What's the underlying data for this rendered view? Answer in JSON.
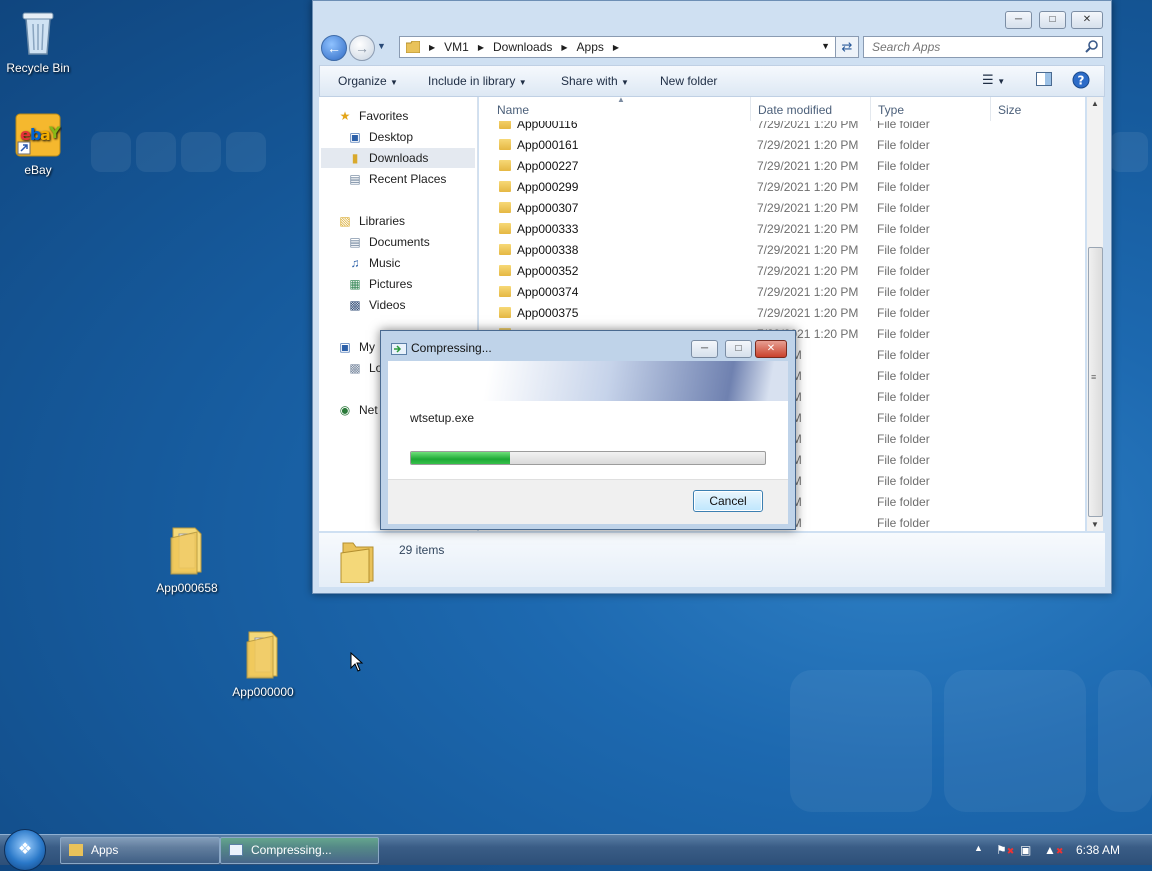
{
  "desktop": {
    "icons": [
      {
        "label": "Recycle Bin",
        "icon": "recycle-bin-icon"
      },
      {
        "label": "eBay",
        "icon": "ebay-icon"
      },
      {
        "label": "App000658",
        "icon": "folder-icon"
      },
      {
        "label": "App000000",
        "icon": "folder-icon"
      }
    ]
  },
  "explorer": {
    "breadcrumb": [
      "VM1",
      "Downloads",
      "Apps"
    ],
    "search_placeholder": "Search Apps",
    "toolbar": {
      "organize": "Organize",
      "include_in_library": "Include in library",
      "share_with": "Share with",
      "new_folder": "New folder"
    },
    "nav": {
      "favorites": "Favorites",
      "desktop": "Desktop",
      "downloads": "Downloads",
      "recent_places": "Recent Places",
      "libraries": "Libraries",
      "documents": "Documents",
      "music": "Music",
      "pictures": "Pictures",
      "videos": "Videos",
      "computer_partial": "My",
      "local_disk_partial": "Lo",
      "network_partial": "Net"
    },
    "columns": {
      "name": "Name",
      "date_modified": "Date modified",
      "type": "Type",
      "size": "Size"
    },
    "rows": [
      {
        "name": "App000116",
        "date": "7/29/2021 1:20 PM",
        "type": "File folder"
      },
      {
        "name": "App000161",
        "date": "7/29/2021 1:20 PM",
        "type": "File folder"
      },
      {
        "name": "App000227",
        "date": "7/29/2021 1:20 PM",
        "type": "File folder"
      },
      {
        "name": "App000299",
        "date": "7/29/2021 1:20 PM",
        "type": "File folder"
      },
      {
        "name": "App000307",
        "date": "7/29/2021 1:20 PM",
        "type": "File folder"
      },
      {
        "name": "App000333",
        "date": "7/29/2021 1:20 PM",
        "type": "File folder"
      },
      {
        "name": "App000338",
        "date": "7/29/2021 1:20 PM",
        "type": "File folder"
      },
      {
        "name": "App000352",
        "date": "7/29/2021 1:20 PM",
        "type": "File folder"
      },
      {
        "name": "App000374",
        "date": "7/29/2021 1:20 PM",
        "type": "File folder"
      },
      {
        "name": "App000375",
        "date": "7/29/2021 1:20 PM",
        "type": "File folder"
      },
      {
        "name": "",
        "date": "7/29/2021 1:20 PM",
        "type": "File folder"
      },
      {
        "name": "",
        "date": "1:20 PM",
        "type": "File folder"
      },
      {
        "name": "",
        "date": "1:20 PM",
        "type": "File folder"
      },
      {
        "name": "",
        "date": "1:20 PM",
        "type": "File folder"
      },
      {
        "name": "",
        "date": "1:20 PM",
        "type": "File folder"
      },
      {
        "name": "",
        "date": "1:20 PM",
        "type": "File folder"
      },
      {
        "name": "",
        "date": "1:20 PM",
        "type": "File folder"
      },
      {
        "name": "",
        "date": "1:20 PM",
        "type": "File folder"
      },
      {
        "name": "",
        "date": "1:20 PM",
        "type": "File folder"
      },
      {
        "name": "",
        "date": "1:20 PM",
        "type": "File folder"
      }
    ],
    "status": "29 items"
  },
  "dialog": {
    "title": "Compressing...",
    "file": "wtsetup.exe",
    "progress": 0.28,
    "cancel": "Cancel"
  },
  "taskbar": {
    "items": [
      "Apps",
      "Compressing..."
    ],
    "clock": "6:38 AM"
  }
}
